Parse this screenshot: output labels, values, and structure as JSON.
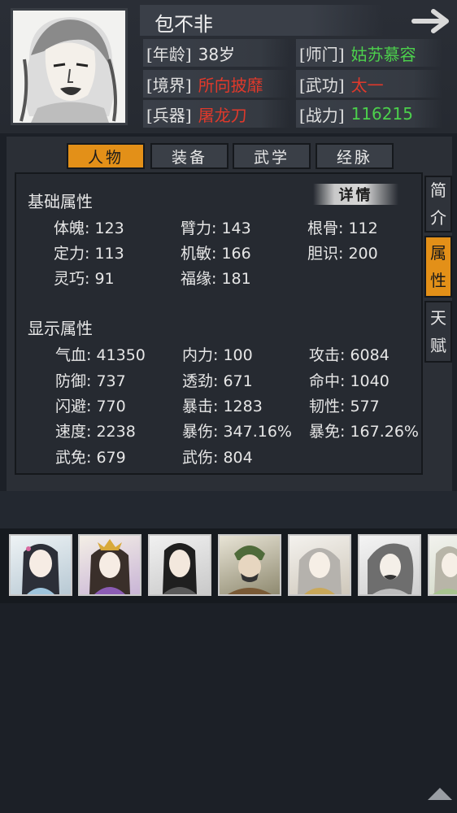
{
  "character": {
    "name": "包不非",
    "age_label": "[年龄]",
    "age_value": "38岁",
    "master_label": "[师门]",
    "master_value": "姑苏慕容",
    "realm_label": "[境界]",
    "realm_value": "所向披靡",
    "martial_label": "[武功]",
    "martial_value": "太一",
    "weapon_label": "[兵器]",
    "weapon_value": "屠龙刀",
    "power_label": "[战力]",
    "power_value": "116215"
  },
  "tabs": [
    "人物",
    "装备",
    "武学",
    "经脉"
  ],
  "active_tab": "人物",
  "side_tabs": [
    "简介",
    "属性",
    "天赋"
  ],
  "detail_button": "详情",
  "basic": {
    "title": "基础属性",
    "stats": [
      "体魄: 123",
      "臂力: 143",
      "根骨: 112",
      "定力: 113",
      "机敏: 166",
      "胆识: 200",
      "灵巧: 91",
      "福缘: 181"
    ]
  },
  "display": {
    "title": "显示属性",
    "stats": [
      "气血: 41350",
      "内力: 100",
      "攻击: 6084",
      "防御: 737",
      "透劲: 671",
      "命中: 1040",
      "闪避: 770",
      "暴击: 1283",
      "韧性: 577",
      "速度: 2238",
      "暴伤: 347.16%",
      "暴免: 167.26%",
      "武免: 679",
      "武伤: 804"
    ]
  },
  "colors": {
    "accent_tab": "#e39018",
    "green_value": "#4cd04c",
    "red_value": "#e0392b"
  },
  "icons": {
    "next": "arrow-right-icon",
    "scroll": "triangle-up-icon"
  }
}
